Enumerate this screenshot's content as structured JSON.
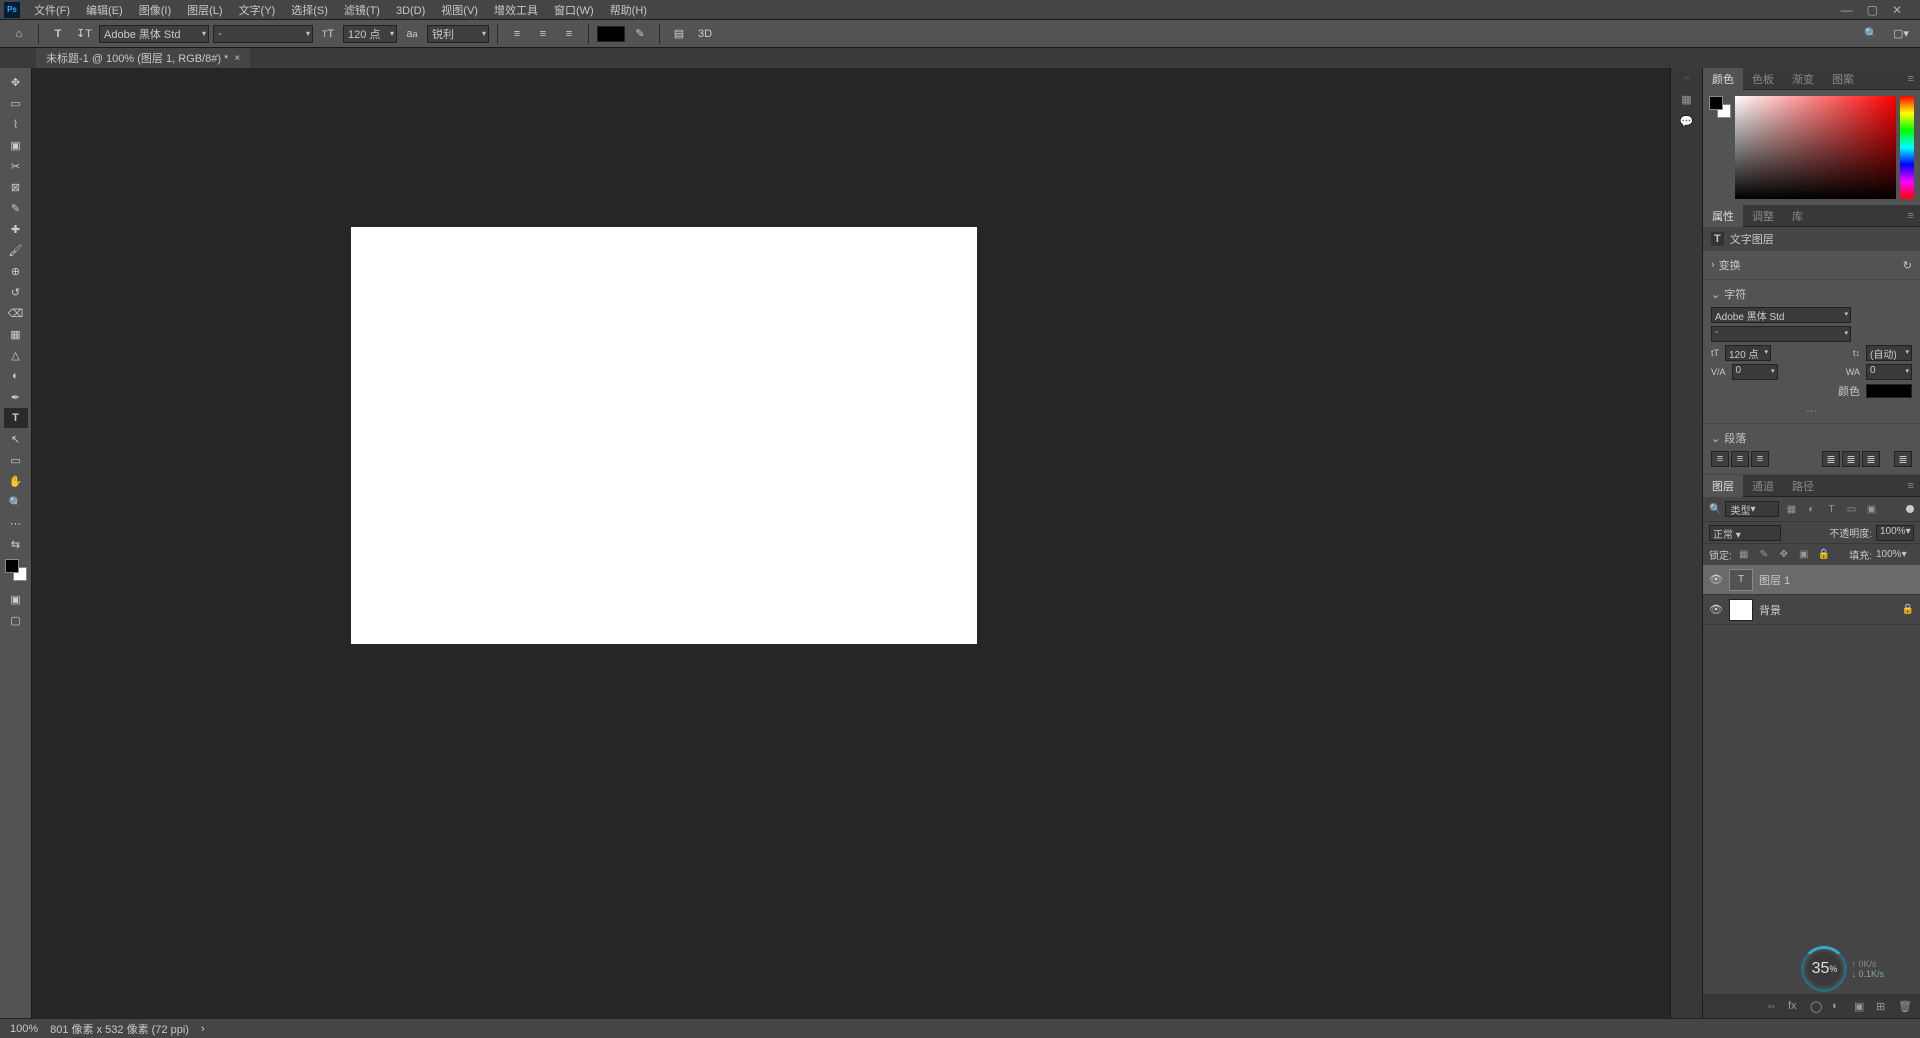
{
  "menu": [
    "文件(F)",
    "编辑(E)",
    "图像(I)",
    "图层(L)",
    "文字(Y)",
    "选择(S)",
    "滤镜(T)",
    "3D(D)",
    "视图(V)",
    "增效工具",
    "窗口(W)",
    "帮助(H)"
  ],
  "optbar": {
    "font": "Adobe 黑体 Std",
    "style": "-",
    "size": "120 点",
    "aa": "锐利",
    "threed": "3D"
  },
  "tab": "未标题-1 @ 100% (图层 1, RGB/8#) *",
  "panels": {
    "color_tabs": [
      "颜色",
      "色板",
      "渐变",
      "图案"
    ],
    "prop_tabs": [
      "属性",
      "调整",
      "库"
    ],
    "prop_title": "文字图层",
    "transform": "变换",
    "character": "字符",
    "char_font": "Adobe 黑体 Std",
    "char_style": "-",
    "char_size": "120 点",
    "char_leading": "(自动)",
    "char_va": "0",
    "char_wa": "0",
    "color_label": "颜色",
    "paragraph": "段落",
    "layer_tabs": [
      "图层",
      "通道",
      "路径"
    ],
    "layer_filter": "类型",
    "blend": "正常",
    "opacity_label": "不透明度:",
    "opacity": "100%",
    "lock_label": "锁定:",
    "fill_label": "填充:",
    "fill": "100%",
    "layer1": "图层 1",
    "layer_bg": "背景"
  },
  "status": {
    "zoom": "100%",
    "docinfo": "801 像素 x 532 像素 (72 ppi)"
  },
  "speed": {
    "pct": "35",
    "unit": "%",
    "up": "0K/s",
    "down": "0.1K/s"
  }
}
